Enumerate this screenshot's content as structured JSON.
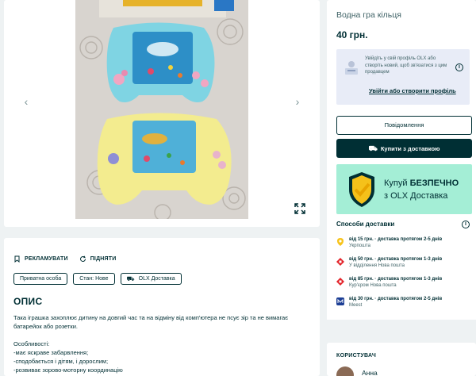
{
  "gallery": {
    "prev_icon": "chevron-left-icon",
    "next_icon": "chevron-right-icon",
    "expand_icon": "expand-icon"
  },
  "details": {
    "actions": [
      {
        "label": "РЕКЛАМУВАТИ",
        "icon": "bookmark-icon"
      },
      {
        "label": "ПІДНЯТИ",
        "icon": "refresh-icon"
      }
    ],
    "tags": [
      "Приватна особа",
      "Стан: Нове",
      "OLX Доставка"
    ],
    "section_title": "ОПИС",
    "description_intro": "Така іграшка захоплює дитину на довгий час та на відміну від комп'ютера не псує зір та не вимагає батарейок або розетки.",
    "features_title": "Особливості:",
    "features": [
      "-має яскраве забарвлення;",
      "-сподобається і дітям, і дорослим;",
      "-розвиває зорово-моторну координацію"
    ]
  },
  "sidebar": {
    "item_title": "Водна гра кільця",
    "price": "40 грн.",
    "profile_prompt": "Увійдіть у свій профіль OLX або створіть новий, щоб зв'язатися з цим продавцем",
    "profile_link": "Увійти або створити профіль",
    "message_button": "Повідомлення",
    "buy_button": "Купити з доставкою",
    "banner_line1_prefix": "Купуй ",
    "banner_line1_bold": "БЕЗПЕЧНО",
    "banner_line2": "з OLX Доставка",
    "delivery_title": "Способи доставки",
    "delivery_options": [
      {
        "main": "від 15 грн. · доставка протягом 2-5 днів",
        "sub": "Укрпошта",
        "icon": "ukrposhta-icon",
        "color": "#f7c31b"
      },
      {
        "main": "від 50 грн. · доставка протягом 1-3 днів",
        "sub": "У відділення Нова пошта",
        "icon": "nova-poshta-icon",
        "color": "#e3242b"
      },
      {
        "main": "від 85 грн. · доставка протягом 1-3 днів",
        "sub": "Кур'єром Нова пошта",
        "icon": "nova-poshta-icon",
        "color": "#e3242b"
      },
      {
        "main": "від 30 грн. · доставка протягом 2-5 днів",
        "sub": "Meest",
        "icon": "meest-icon",
        "color": "#1d3f95"
      }
    ],
    "user_title": "КОРИСТУВАЧ",
    "user_name": "Анна"
  }
}
